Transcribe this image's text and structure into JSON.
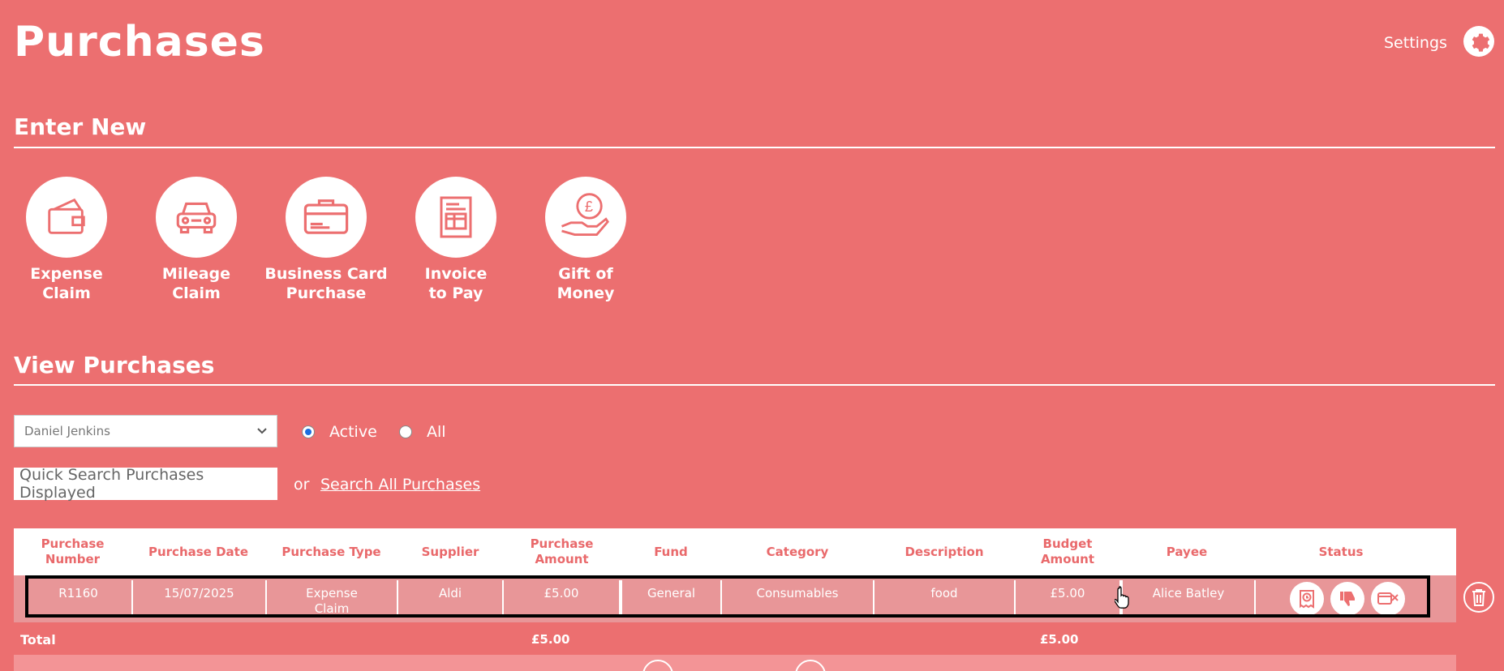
{
  "page": {
    "title": "Purchases"
  },
  "header": {
    "settings_label": "Settings",
    "settings_icon": "gear-icon"
  },
  "sections": {
    "enter_new": "Enter New",
    "view_purchases": "View Purchases"
  },
  "tiles": [
    {
      "line1": "Expense",
      "line2": "Claim",
      "icon": "wallet-icon"
    },
    {
      "line1": "Mileage",
      "line2": "Claim",
      "icon": "car-icon"
    },
    {
      "line1": "Business Card",
      "line2": "Purchase",
      "icon": "briefcase-card-icon"
    },
    {
      "line1": "Invoice",
      "line2": "to Pay",
      "icon": "invoice-icon"
    },
    {
      "line1": "Gift of",
      "line2": "Money",
      "icon": "hand-pound-icon"
    }
  ],
  "filters": {
    "user_select": "Daniel Jenkins",
    "radio_active": "Active",
    "radio_all": "All",
    "active_selected": true,
    "search_placeholder": "Quick Search Purchases Displayed",
    "or_text": "or",
    "search_all_link": "Search All Purchases"
  },
  "table": {
    "headers": {
      "number": "Purchase Number",
      "date": "Purchase Date",
      "type": "Purchase Type",
      "supplier": "Supplier",
      "amount": "Purchase Amount",
      "fund": "Fund",
      "category": "Category",
      "description": "Description",
      "budget": "Budget Amount",
      "payee": "Payee",
      "status": "Status"
    },
    "rows": [
      {
        "number": "R1160",
        "date": "15/07/2025",
        "type": "Expense Claim",
        "supplier": "Aldi",
        "amount": "£5.00",
        "fund": "General",
        "category": "Consumables",
        "description": "food",
        "budget": "£5.00",
        "payee": "Alice Batley",
        "status_icons": [
          "receipt-clock-icon",
          "thumbs-down-icon",
          "card-cancel-icon"
        ]
      }
    ],
    "total": {
      "label": "Total",
      "amount": "£5.00",
      "budget": "£5.00"
    }
  },
  "colors": {
    "background": "#ec6f70",
    "header_text": "#e9696b",
    "row": "#e89698"
  }
}
